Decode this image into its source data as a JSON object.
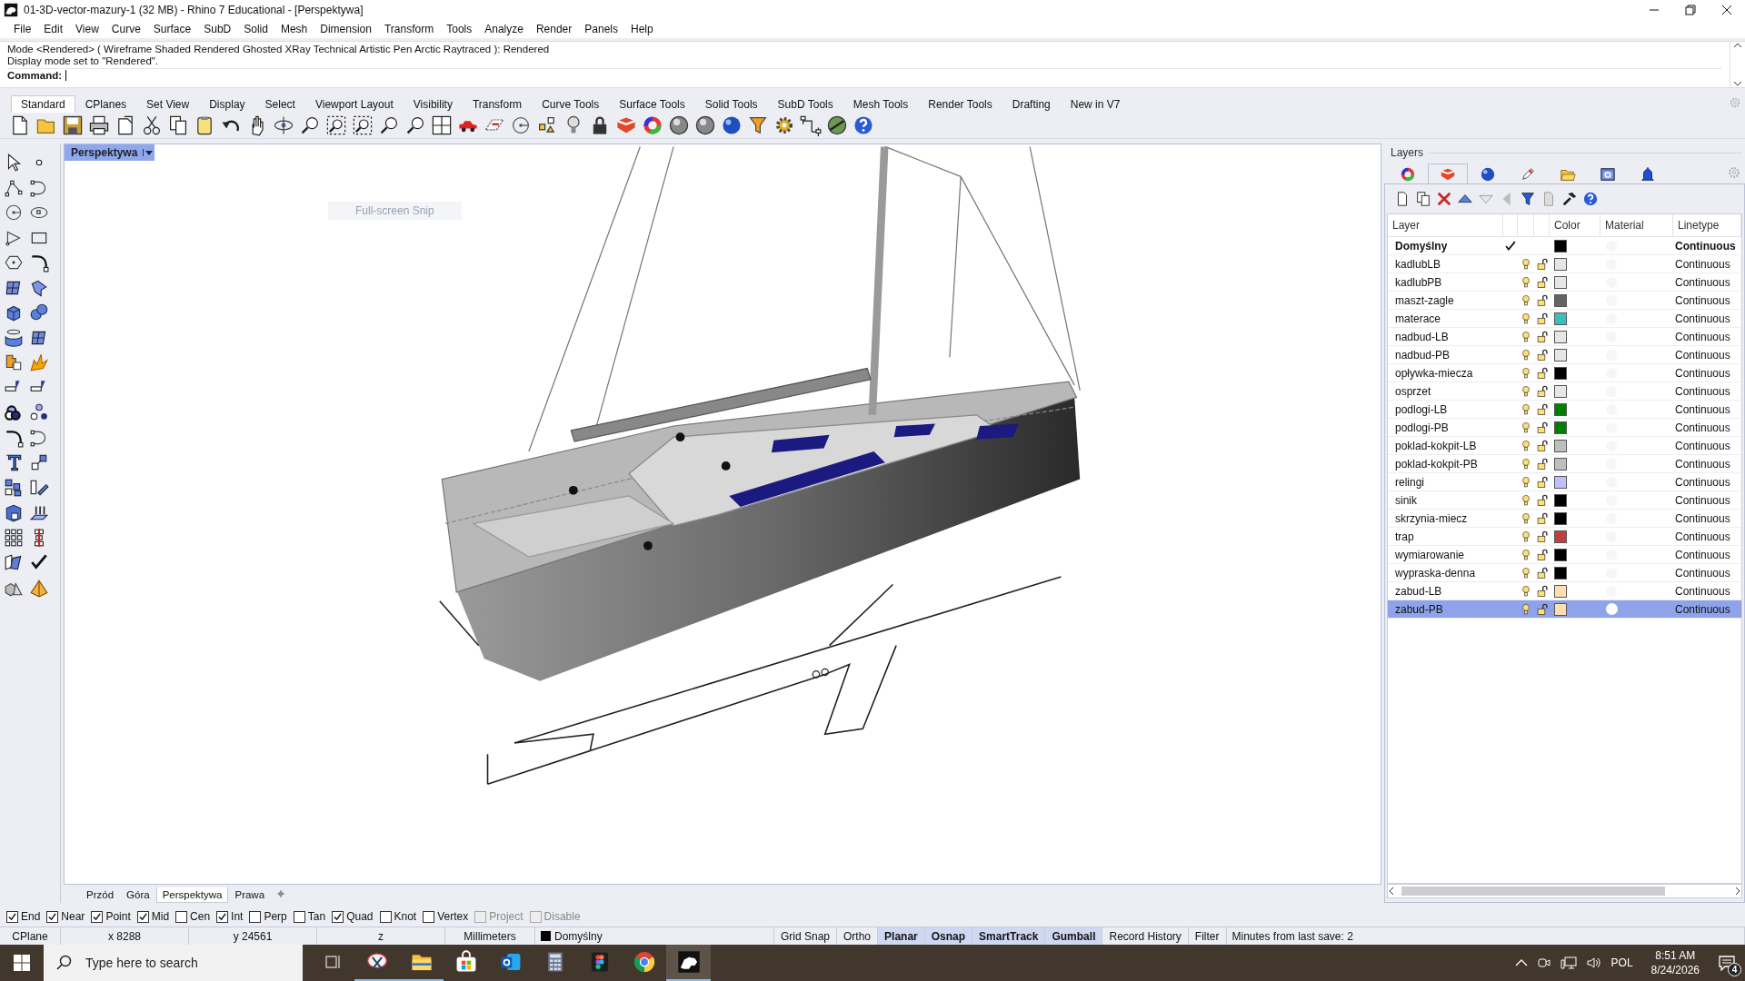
{
  "window": {
    "title": "01-3D-vector-mazury-1 (32 MB) - Rhino 7 Educational - [Perspektywa]"
  },
  "menu": [
    "File",
    "Edit",
    "View",
    "Curve",
    "Surface",
    "SubD",
    "Solid",
    "Mesh",
    "Dimension",
    "Transform",
    "Tools",
    "Analyze",
    "Render",
    "Panels",
    "Help"
  ],
  "command_history": [
    "Mode <Rendered> ( Wireframe  Shaded  Rendered  Ghosted  XRay  Technical  Artistic  Pen  Arctic  Raytraced ): Rendered",
    "Display mode set to \"Rendered\"."
  ],
  "command_prompt": {
    "label": "Command:"
  },
  "toolbar_tabs": [
    {
      "label": "Standard",
      "selected": true
    },
    {
      "label": "CPlanes",
      "selected": false
    },
    {
      "label": "Set View",
      "selected": false
    },
    {
      "label": "Display",
      "selected": false
    },
    {
      "label": "Select",
      "selected": false
    },
    {
      "label": "Viewport Layout",
      "selected": false
    },
    {
      "label": "Visibility",
      "selected": false
    },
    {
      "label": "Transform",
      "selected": false
    },
    {
      "label": "Curve Tools",
      "selected": false
    },
    {
      "label": "Surface Tools",
      "selected": false
    },
    {
      "label": "Solid Tools",
      "selected": false
    },
    {
      "label": "SubD Tools",
      "selected": false
    },
    {
      "label": "Mesh Tools",
      "selected": false
    },
    {
      "label": "Render Tools",
      "selected": false
    },
    {
      "label": "Drafting",
      "selected": false
    },
    {
      "label": "New in V7",
      "selected": false
    }
  ],
  "viewport": {
    "title": "Perspektywa",
    "overlay_label": "Full-screen Snip"
  },
  "viewport_tabs": [
    {
      "label": "Przód",
      "selected": false
    },
    {
      "label": "Góra",
      "selected": false
    },
    {
      "label": "Perspektywa",
      "selected": true
    },
    {
      "label": "Prawa",
      "selected": false
    }
  ],
  "layers_panel": {
    "title": "Layers",
    "tabs": [
      {
        "selected": false
      },
      {
        "selected": true
      },
      {
        "selected": false
      },
      {
        "selected": false
      },
      {
        "selected": false
      },
      {
        "selected": false
      },
      {
        "selected": false
      }
    ],
    "columns": [
      "Layer",
      "Color",
      "Material",
      "Linetype"
    ],
    "layers": [
      {
        "name": "Domyślny",
        "current": true,
        "color": "#000000",
        "linetype": "Continuous",
        "selected": false
      },
      {
        "name": "kadlubLB",
        "current": false,
        "color": "#e6e6e6",
        "linetype": "Continuous",
        "selected": false
      },
      {
        "name": "kadlubPB",
        "current": false,
        "color": "#e6e6e6",
        "linetype": "Continuous",
        "selected": false
      },
      {
        "name": "maszt-zagle",
        "current": false,
        "color": "#646464",
        "linetype": "Continuous",
        "selected": false
      },
      {
        "name": "materace",
        "current": false,
        "color": "#3cbebe",
        "linetype": "Continuous",
        "selected": false
      },
      {
        "name": "nadbud-LB",
        "current": false,
        "color": "#e6e6e6",
        "linetype": "Continuous",
        "selected": false
      },
      {
        "name": "nadbud-PB",
        "current": false,
        "color": "#e6e6e6",
        "linetype": "Continuous",
        "selected": false
      },
      {
        "name": "opływka-miecza",
        "current": false,
        "color": "#000000",
        "linetype": "Continuous",
        "selected": false
      },
      {
        "name": "osprzet",
        "current": false,
        "color": "#e6e6e6",
        "linetype": "Continuous",
        "selected": false
      },
      {
        "name": "podlogi-LB",
        "current": false,
        "color": "#007f00",
        "linetype": "Continuous",
        "selected": false
      },
      {
        "name": "podlogi-PB",
        "current": false,
        "color": "#007f00",
        "linetype": "Continuous",
        "selected": false
      },
      {
        "name": "poklad-kokpit-LB",
        "current": false,
        "color": "#bebebe",
        "linetype": "Continuous",
        "selected": false
      },
      {
        "name": "poklad-kokpit-PB",
        "current": false,
        "color": "#bebebe",
        "linetype": "Continuous",
        "selected": false
      },
      {
        "name": "relingi",
        "current": false,
        "color": "#bfbfff",
        "linetype": "Continuous",
        "selected": false
      },
      {
        "name": "sinik",
        "current": false,
        "color": "#000000",
        "linetype": "Continuous",
        "selected": false
      },
      {
        "name": "skrzynia-miecz",
        "current": false,
        "color": "#000000",
        "linetype": "Continuous",
        "selected": false
      },
      {
        "name": "trap",
        "current": false,
        "color": "#c04040",
        "linetype": "Continuous",
        "selected": false
      },
      {
        "name": "wymiarowanie",
        "current": false,
        "color": "#000000",
        "linetype": "Continuous",
        "selected": false
      },
      {
        "name": "wypraska-denna",
        "current": false,
        "color": "#000000",
        "linetype": "Continuous",
        "selected": false
      },
      {
        "name": "zabud-LB",
        "current": false,
        "color": "#ffdfb0",
        "linetype": "Continuous",
        "selected": false
      },
      {
        "name": "zabud-PB",
        "current": false,
        "color": "#ffdfb0",
        "linetype": "Continuous",
        "selected": true
      }
    ]
  },
  "osnaps": [
    {
      "label": "End",
      "checked": true,
      "disabled": false
    },
    {
      "label": "Near",
      "checked": true,
      "disabled": false
    },
    {
      "label": "Point",
      "checked": true,
      "disabled": false
    },
    {
      "label": "Mid",
      "checked": true,
      "disabled": false
    },
    {
      "label": "Cen",
      "checked": false,
      "disabled": false
    },
    {
      "label": "Int",
      "checked": true,
      "disabled": false
    },
    {
      "label": "Perp",
      "checked": false,
      "disabled": false
    },
    {
      "label": "Tan",
      "checked": false,
      "disabled": false
    },
    {
      "label": "Quad",
      "checked": true,
      "disabled": false
    },
    {
      "label": "Knot",
      "checked": false,
      "disabled": false
    },
    {
      "label": "Vertex",
      "checked": false,
      "disabled": false
    },
    {
      "label": "Project",
      "checked": false,
      "disabled": true
    },
    {
      "label": "Disable",
      "checked": false,
      "disabled": true
    }
  ],
  "status_bar": {
    "cplane": "CPlane",
    "x": "x 8288",
    "y": "y 24561",
    "z": "z",
    "units": "Millimeters",
    "layer": "Domyślny",
    "toggles": [
      {
        "label": "Grid Snap",
        "on": false
      },
      {
        "label": "Ortho",
        "on": false
      },
      {
        "label": "Planar",
        "on": true
      },
      {
        "label": "Osnap",
        "on": true
      },
      {
        "label": "SmartTrack",
        "on": true
      },
      {
        "label": "Gumball",
        "on": true
      },
      {
        "label": "Record History",
        "on": false
      },
      {
        "label": "Filter",
        "on": false
      }
    ],
    "info": "Minutes from last save: 2"
  },
  "taskbar": {
    "search_placeholder": "Type here to search",
    "apps": [
      {
        "kind": "task-view",
        "running": false,
        "selected": false
      },
      {
        "kind": "snipping",
        "running": true,
        "selected": false
      },
      {
        "kind": "explorer",
        "running": true,
        "selected": false
      },
      {
        "kind": "store",
        "running": false,
        "selected": false
      },
      {
        "kind": "mail",
        "running": false,
        "selected": false
      },
      {
        "kind": "calculator",
        "running": false,
        "selected": false
      },
      {
        "kind": "figma",
        "running": false,
        "selected": false
      },
      {
        "kind": "chrome",
        "running": false,
        "selected": false
      },
      {
        "kind": "rhino",
        "running": true,
        "selected": true
      }
    ],
    "language": "POL",
    "time": "8:51 AM",
    "date": "8/24/2026",
    "notifications": "4"
  }
}
